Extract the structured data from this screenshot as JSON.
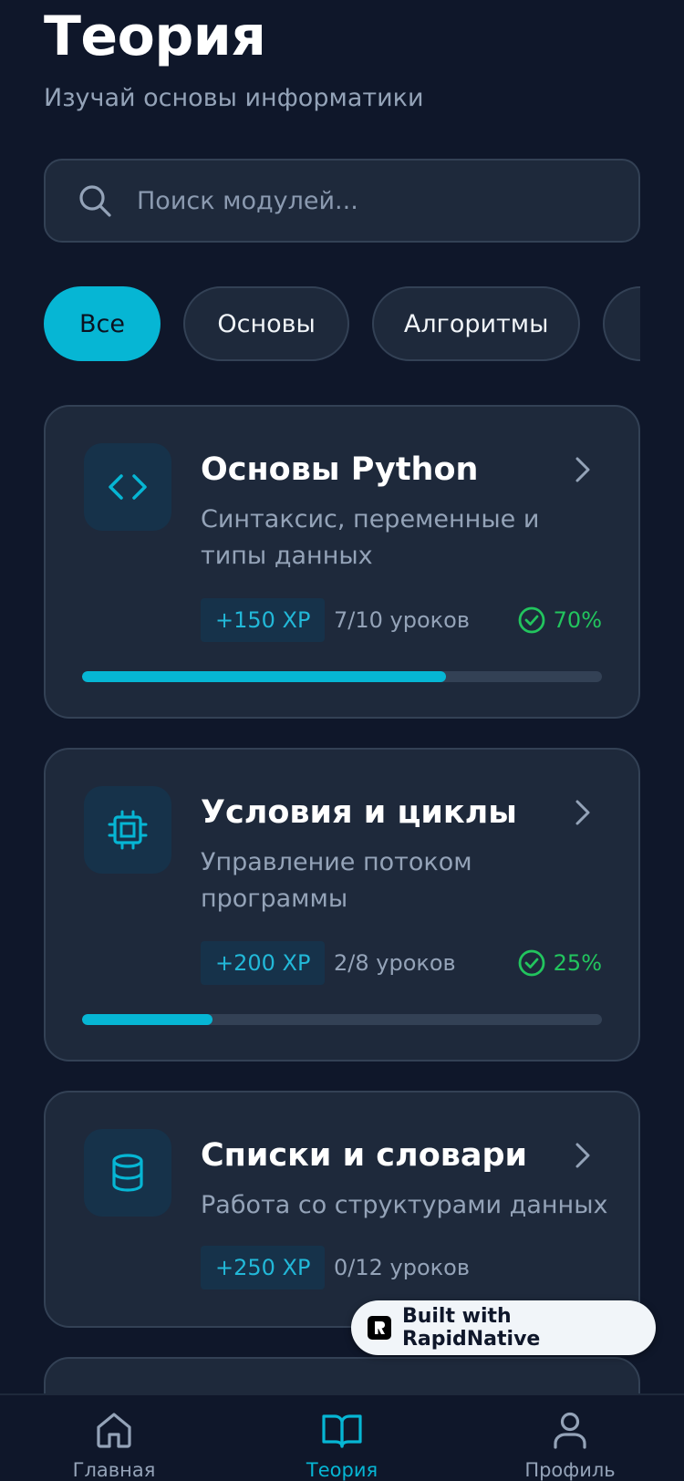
{
  "header": {
    "title": "Теория",
    "subtitle": "Изучай основы информатики"
  },
  "search": {
    "placeholder": "Поиск модулей...",
    "icon": "search-icon"
  },
  "filters": [
    {
      "label": "Все",
      "active": true
    },
    {
      "label": "Основы",
      "active": false
    },
    {
      "label": "Алгоритмы",
      "active": false
    },
    {
      "label": "",
      "active": false
    }
  ],
  "modules": [
    {
      "icon": "code-icon",
      "title": "Основы Python",
      "description": "Синтаксис, переменные и типы данных",
      "xp": "+150 XP",
      "lessons": "7/10 уроков",
      "percent": "70%",
      "progress": 0.7
    },
    {
      "icon": "cpu-icon",
      "title": "Условия и циклы",
      "description": "Управление потоком программы",
      "xp": "+200 XP",
      "lessons": "2/8 уроков",
      "percent": "25%",
      "progress": 0.25
    },
    {
      "icon": "database-icon",
      "title": "Списки и словари",
      "description": "Работа со структурами данных",
      "xp": "+250 XP",
      "lessons": "0/12 уроков",
      "percent": "",
      "progress": 0
    }
  ],
  "badge": {
    "text": "Built with RapidNative"
  },
  "tabbar": [
    {
      "label": "Главная",
      "icon": "home-icon",
      "active": false
    },
    {
      "label": "Теория",
      "icon": "book-icon",
      "active": true
    },
    {
      "label": "Профиль",
      "icon": "user-icon",
      "active": false
    }
  ],
  "colors": {
    "background": "#0f172a",
    "card": "#1e293b",
    "accent": "#06b6d4",
    "success": "#22c55e",
    "muted": "#94a3b8"
  }
}
